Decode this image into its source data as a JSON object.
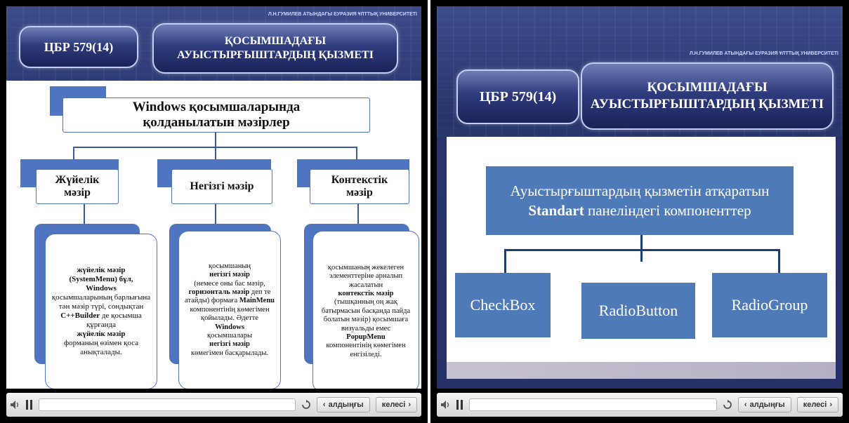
{
  "left_slide": {
    "university": "Л.Н.ГУМИЛЕВ АТЫНДАҒЫ ЕУРАЗИЯ ҰЛТТЫҚ УНИВЕРСИТЕТІ",
    "course_code": "ЦБР 579(14)",
    "title_line1": "ҚОСЫМШАДАҒЫ",
    "title_line2": "АУЫСТЫРҒЫШТАРДЫҢ ҚЫЗМЕТІ",
    "header_line1": "Windows қосымшаларында",
    "header_line2": "қолданылатын мәзірлер",
    "categories": [
      {
        "line1": "Жүйелік",
        "line2": "мәзір"
      },
      {
        "line1": "Негізгі мәзір",
        "line2": ""
      },
      {
        "line1": "Контекстік",
        "line2": "мәзір"
      }
    ],
    "desc1": {
      "p1": "жүйелік мәзір",
      "p2": "(SystemMenu)  бұл,",
      "p3": "Windows",
      "p4": "қосымшаларының барлығына тән мәзір түрі, сондықтан",
      "p5": "C++Builder",
      "p6": " де қосымша құрғанда",
      "p7": "жүйелік мәзір",
      "p8": "форманың өзімен қоса анықталады."
    },
    "desc2": {
      "p1": "қосымшаның",
      "p2": "негізгі мәзір",
      "p3": "(немесе оны бас мәзір,",
      "p4": "горизонталь мәзір",
      "p5": "деп те атайды) формаға",
      "p6": "MainMenu",
      "p7": "компонентінің көмегімен қойылады. Әдетте",
      "p8": "Windows",
      "p9": "қосымшалары",
      "p10": "негізгі мәзір",
      "p11": "көмегімен басқарылады."
    },
    "desc3": {
      "p1": "қосымшаның жекелеген элементтеріне арналып жасалатын",
      "p2": "контекстік мәзір",
      "p3": "(тышқанның оң жақ батырмасын басқанда пайда болатын мәзір) қосымшаға визуальды емес",
      "p4": "PopupMenu",
      "p5": "компонентінің көмегімен енгізіледі."
    }
  },
  "right_slide": {
    "university": "Л.Н.ГУМИЛЕВ АТЫНДАҒЫ ЕУРАЗИЯ ҰЛТТЫҚ УНИВЕРСИТЕТІ",
    "course_code": "ЦБР 579(14)",
    "title_line1": "ҚОСЫМШАДАҒЫ",
    "title_line2": "АУЫСТЫРҒЫШТАРДЫҢ ҚЫЗМЕТІ",
    "header_line1": "Ауыстырғыштардың қызметін  атқаратын",
    "header_bold": "Standart",
    "header_line2_rest": " панеліндегі компоненттер",
    "components": [
      "CheckBox",
      "RadioButton",
      "RadioGroup"
    ]
  },
  "player": {
    "prev_label": "алдыңғы",
    "next_label": "келесі",
    "progress_fraction": 0.0
  },
  "icons": {
    "volume": "volume-icon",
    "pause": "pause-icon",
    "replay": "replay-icon",
    "prev": "chevron-left-icon",
    "next": "chevron-right-icon"
  }
}
